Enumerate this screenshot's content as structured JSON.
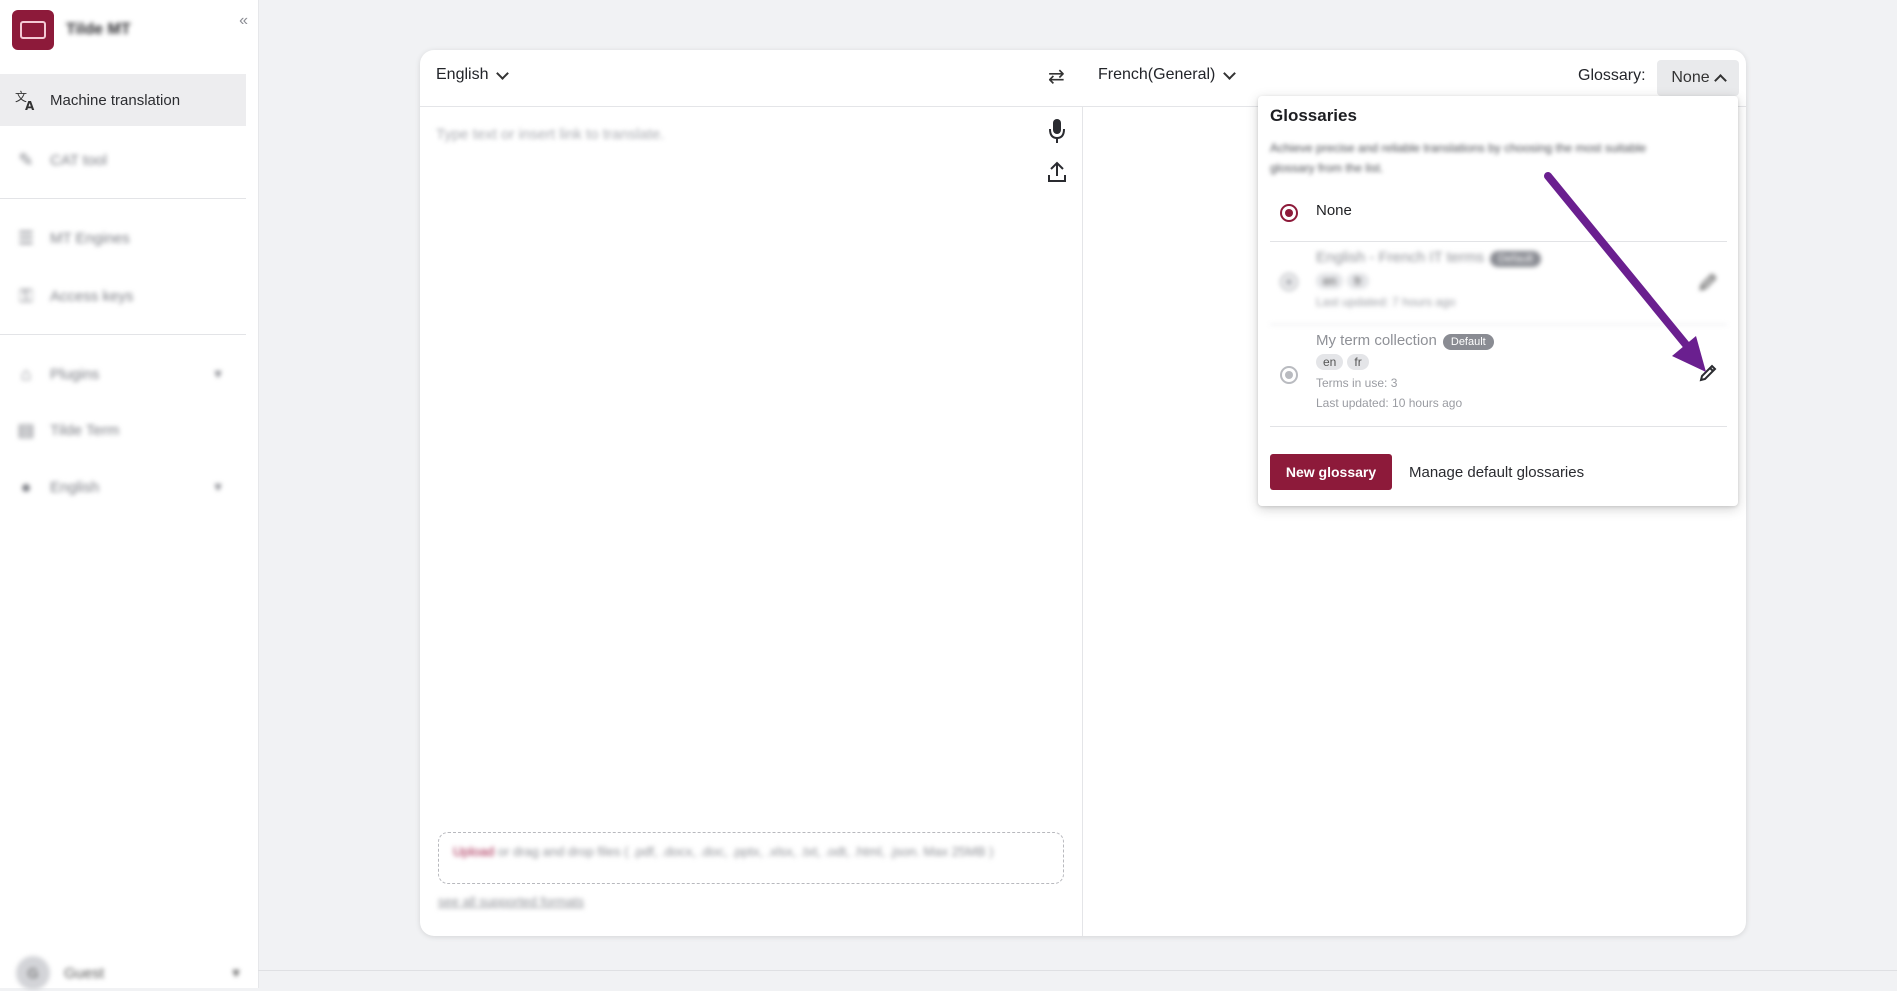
{
  "sidebar": {
    "app_name": "Tilde MT",
    "collapse_icon": "«",
    "items": [
      {
        "label": "Machine translation",
        "icon": "translate-icon",
        "active": true
      },
      {
        "label": "CAT tool",
        "icon": "cat-tool-icon"
      },
      {
        "label": "MT Engines",
        "icon": "engines-icon"
      },
      {
        "label": "Access keys",
        "icon": "key-icon"
      },
      {
        "label": "Plugins",
        "icon": "plugin-icon"
      },
      {
        "label": "Tilde Term",
        "icon": "term-icon"
      },
      {
        "label": "English",
        "icon": "globe-icon"
      }
    ],
    "user": {
      "initial": "G",
      "name": "Guest"
    }
  },
  "translator": {
    "source_language": "English",
    "target_language": "French(General)",
    "glossary_label": "Glossary:",
    "glossary_value": "None",
    "source_placeholder": "Type text or insert link to translate.",
    "upload_link": "Upload",
    "upload_text": " or drag and drop files ( .pdf, .docx, .doc, .pptx, .xlsx, .txt, .odt, .html, .json. Max 25MB )",
    "formats_link": "see all supported formats"
  },
  "glossary_popup": {
    "title": "Glossaries",
    "description": "Achieve precise and reliable translations by choosing the most suitable glossary from the list.",
    "options": [
      {
        "name": "None",
        "selected": true
      },
      {
        "name": "English - French IT terms",
        "badge": "Default",
        "languages": [
          "en",
          "fr"
        ],
        "updated": "Last updated: 7 hours ago"
      },
      {
        "name": "My term collection",
        "badge": "Default",
        "languages": [
          "en",
          "fr"
        ],
        "terms": "Terms in use: 3",
        "updated": "Last updated: 10 hours ago"
      }
    ],
    "new_button": "New glossary",
    "manage_link": "Manage default glossaries"
  },
  "colors": {
    "brand": "#8d1a3a",
    "annotation_arrow": "#6a1f8f"
  }
}
